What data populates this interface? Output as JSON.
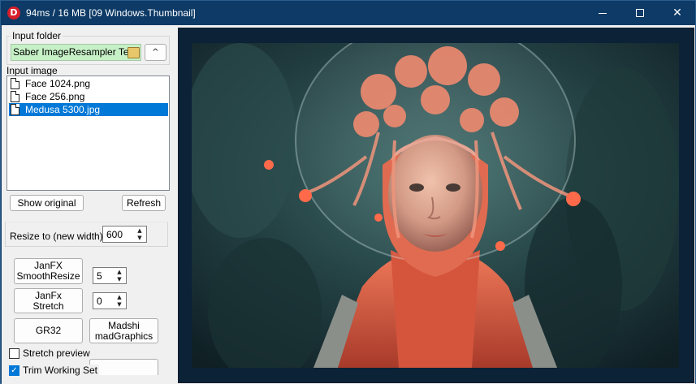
{
  "window": {
    "title": "94ms / 16 MB [09 Windows.Thumbnail]",
    "app_icon_letter": "D",
    "minimize_glyph": "",
    "close_glyph": "✕"
  },
  "input_folder": {
    "group_label": "Input folder",
    "path_value": "Saber ImageResampler Test\\",
    "up_glyph": "^"
  },
  "input_image": {
    "label": "Input image",
    "files": [
      {
        "name": "Face 1024.png",
        "selected": false
      },
      {
        "name": "Face 256.png",
        "selected": false
      },
      {
        "name": "Medusa 5300.jpg",
        "selected": true
      }
    ]
  },
  "buttons": {
    "show_original": "Show original",
    "refresh": "Refresh",
    "janfx_smoothresize": "JanFX\nSmoothResize",
    "janfx_stretch": "JanFx\nStretch",
    "gr32": "GR32",
    "madshi": "Madshi\nmadGraphics"
  },
  "resize": {
    "label": "Resize to (new width):",
    "value": "600"
  },
  "spinners": {
    "smoothresize_value": "5",
    "stretch_value": "0",
    "arrow_up": "▲",
    "arrow_down": "▼"
  },
  "options": {
    "stretch_preview": {
      "label": "Stretch preview",
      "checked": false
    },
    "trim_working_set": {
      "label": "Trim Working Set",
      "checked": true,
      "check_glyph": "✓"
    }
  },
  "preview": {
    "description_colors": {
      "background": "#1d3a3b",
      "suit": "#e0654a",
      "hair": "#f0957c",
      "skin": "#d9a48e",
      "frame": "#0b2237"
    }
  }
}
